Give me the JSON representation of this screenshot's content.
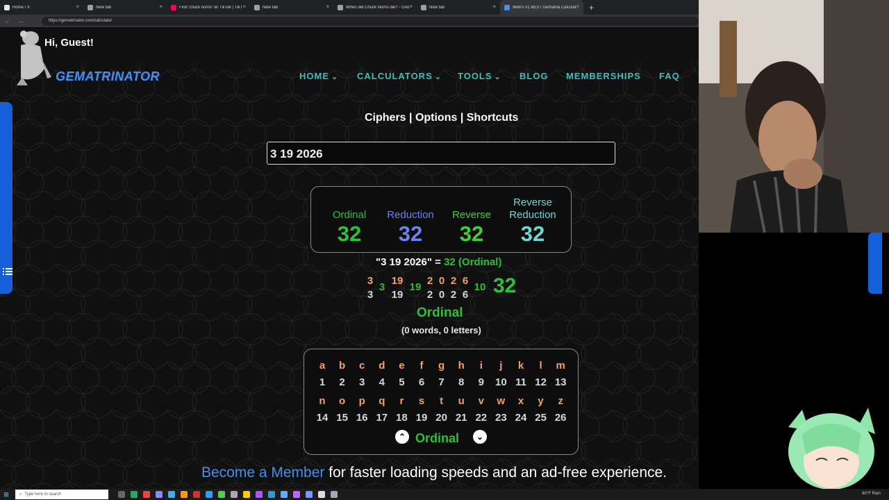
{
  "browser": {
    "tabs": [
      {
        "label": "Home / X",
        "color": "#e8e8e8"
      },
      {
        "label": "New tab",
        "color": "#9aa0a6"
      },
      {
        "label": "Find 'chuck norris' on TikTok | TikT",
        "color": "#ff0050"
      },
      {
        "label": "New tab",
        "color": "#9aa0a6"
      },
      {
        "label": "When did Chuck Norris die? - Goo",
        "color": "#9aa0a6"
      },
      {
        "label": "New tab",
        "color": "#9aa0a6"
      },
      {
        "label": "Web's #1 BEST Gematria Calculat",
        "color": "#4b8de8"
      }
    ],
    "new_tab_icon": "plus-icon",
    "url": "https://gematrinator.com/calculator"
  },
  "header": {
    "greeting": "Hi, Guest!",
    "logo_text": "GEMATRINATOR",
    "nav": [
      {
        "label": "HOME",
        "dropdown": true,
        "chevron": "⌄"
      },
      {
        "label": "CALCULATORS",
        "dropdown": true,
        "chevron": "⌄"
      },
      {
        "label": "TOOLS",
        "dropdown": true,
        "chevron": "⌄"
      },
      {
        "label": "BLOG",
        "dropdown": false,
        "chevron": ""
      },
      {
        "label": "MEMBERSHIPS",
        "dropdown": false,
        "chevron": ""
      },
      {
        "label": "FAQ",
        "dropdown": false,
        "chevron": ""
      }
    ]
  },
  "main": {
    "options_line": "Ciphers | Options | Shortcuts",
    "input_value": "3 19 2026",
    "results": [
      {
        "label_line1": "Ordinal",
        "label_line2": "",
        "value": "32",
        "color": "#2ec038"
      },
      {
        "label_line1": "Reduction",
        "label_line2": "",
        "value": "32",
        "color": "#6c82ee"
      },
      {
        "label_line1": "Reverse",
        "label_line2": "",
        "value": "32",
        "color": "#3fd035"
      },
      {
        "label_line1": "Reverse",
        "label_line2": "Reduction",
        "value": "32",
        "color": "#6fd6d3"
      }
    ],
    "equation": {
      "quoted": "\"3 19 2026\" = ",
      "value": "32 (Ordinal)"
    },
    "breakdown": [
      {
        "top": "3",
        "bottom": "3"
      },
      {
        "sum": "3"
      },
      {
        "top": "19",
        "bottom": "19"
      },
      {
        "sum": "19"
      },
      {
        "top": "2",
        "bottom": "2"
      },
      {
        "top": "0",
        "bottom": "0"
      },
      {
        "top": "2",
        "bottom": "2"
      },
      {
        "top": "6",
        "bottom": "6"
      },
      {
        "sum": "10"
      },
      {
        "total": "32"
      }
    ],
    "cipher_name": "Ordinal",
    "word_count": "(0 words, 0 letters)",
    "chart": {
      "rows": [
        {
          "letters": [
            "a",
            "b",
            "c",
            "d",
            "e",
            "f",
            "g",
            "h",
            "i",
            "j",
            "k",
            "l",
            "m"
          ],
          "numbers": [
            "1",
            "2",
            "3",
            "4",
            "5",
            "6",
            "7",
            "8",
            "9",
            "10",
            "11",
            "12",
            "13"
          ]
        },
        {
          "letters": [
            "n",
            "o",
            "p",
            "q",
            "r",
            "s",
            "t",
            "u",
            "v",
            "w",
            "x",
            "y",
            "z"
          ],
          "numbers": [
            "14",
            "15",
            "16",
            "17",
            "18",
            "19",
            "20",
            "21",
            "22",
            "23",
            "24",
            "25",
            "26"
          ]
        }
      ],
      "cipher_label": "Ordinal",
      "prev_icon": "chevron-up-icon",
      "next_icon": "chevron-down-icon"
    },
    "cta_link": "Become a Member",
    "cta_text": " for faster loading speeds and an ad-free experience."
  },
  "taskbar": {
    "search_placeholder": "Type here to search",
    "tray_text": "60°F Rain"
  }
}
